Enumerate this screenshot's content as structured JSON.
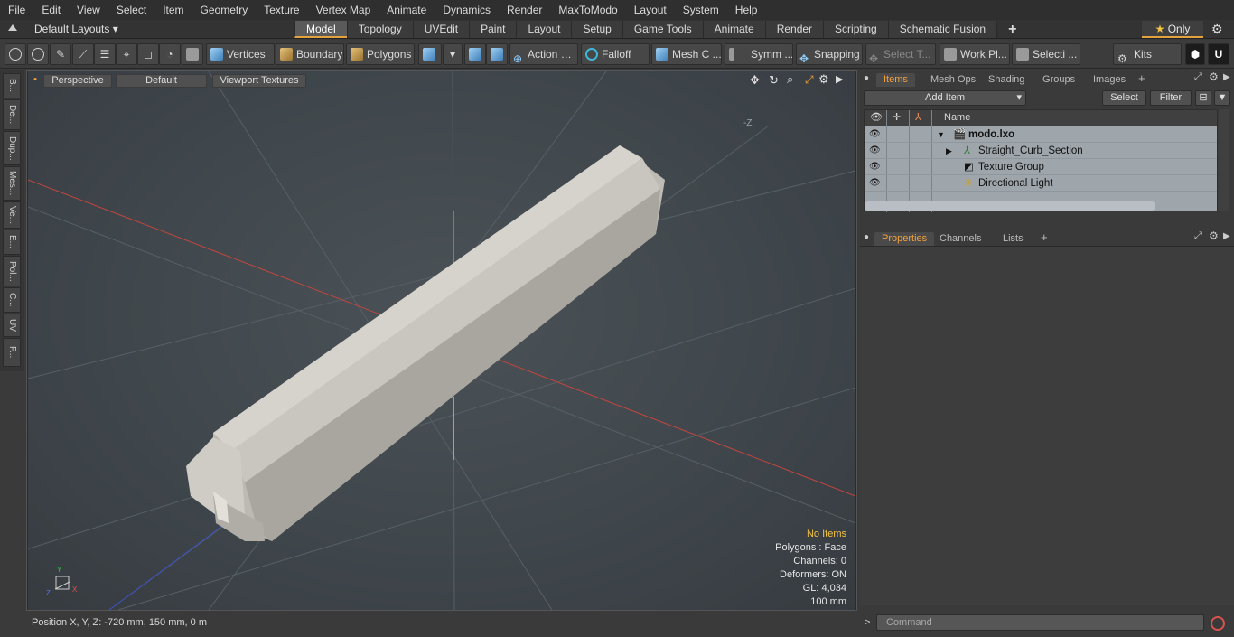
{
  "menu": [
    "File",
    "Edit",
    "View",
    "Select",
    "Item",
    "Geometry",
    "Texture",
    "Vertex Map",
    "Animate",
    "Dynamics",
    "Render",
    "MaxToModo",
    "Layout",
    "System",
    "Help"
  ],
  "layout_label": "Default Layouts",
  "mode_tabs": [
    "Model",
    "Topology",
    "UVEdit",
    "Paint",
    "Layout",
    "Setup",
    "Game Tools",
    "Animate",
    "Render",
    "Scripting",
    "Schematic Fusion"
  ],
  "only_label": "Only",
  "toolbar": {
    "vertices": "Vertices",
    "boundary": "Boundary",
    "polygons": "Polygons",
    "action": "Action",
    "falloff": "Falloff",
    "meshc": "Mesh C ...",
    "symm": "Symm ...",
    "snapping": "Snapping",
    "selectt": "Select T...",
    "workpl": "Work Pl...",
    "selecti": "Selecti ...",
    "kits": "Kits"
  },
  "left_tabs": [
    "B...",
    "De...",
    "Dup...",
    "Mes...",
    "Ve...",
    "E...",
    "Pol...",
    "C...",
    "UV",
    "F..."
  ],
  "viewport": {
    "perspective": "Perspective",
    "default": "Default",
    "textures": "Viewport Textures",
    "axis_z_label": "-Z",
    "info": {
      "selection": "No Items",
      "polygons": "Polygons : Face",
      "channels": "Channels: 0",
      "deformers": "Deformers: ON",
      "gl": "GL: 4,034",
      "scale": "100 mm"
    }
  },
  "status": "Position X, Y, Z:   -720 mm, 150 mm, 0 m",
  "items_panel": {
    "tabs": [
      "Items",
      "Mesh Ops",
      "Shading",
      "Groups",
      "Images"
    ],
    "add_item": "Add Item",
    "select": "Select",
    "filter": "Filter",
    "name_header": "Name",
    "rows": [
      "modo.lxo",
      "Straight_Curb_Section",
      "Texture Group",
      "Directional Light"
    ]
  },
  "props_panel": {
    "tabs": [
      "Properties",
      "Channels",
      "Lists"
    ]
  },
  "command_placeholder": "Command",
  "colors": {
    "accent": "#e3a23e",
    "x_axis": "#d23a3a",
    "y_axis": "#3ad24a",
    "z_axis": "#3a4ad2"
  }
}
